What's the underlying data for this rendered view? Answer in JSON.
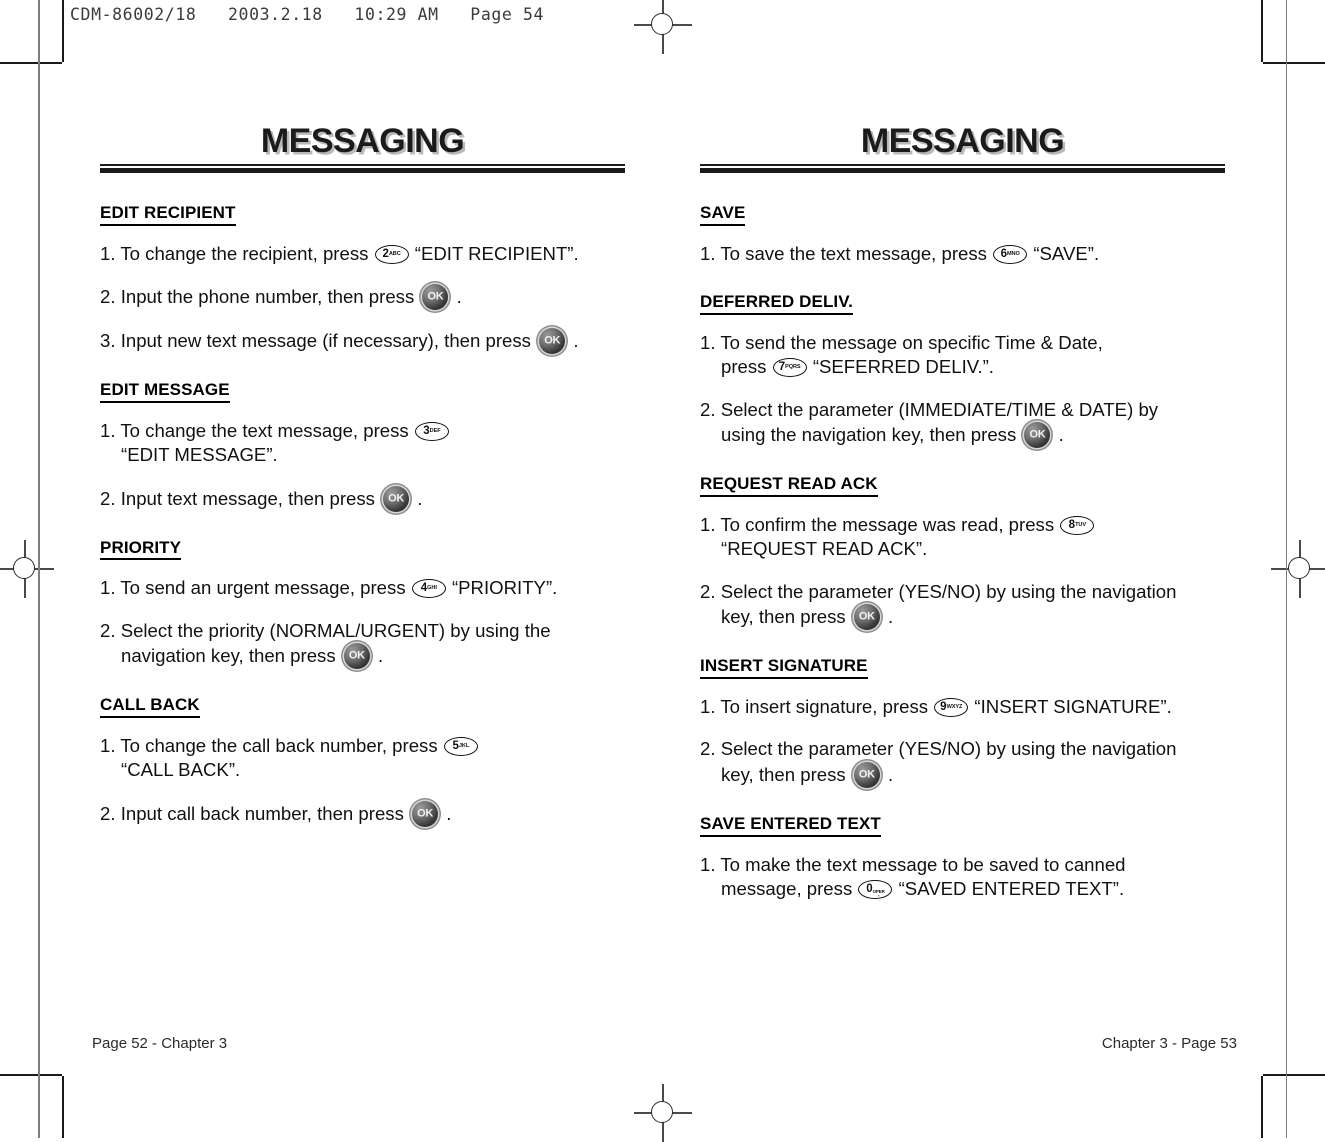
{
  "proof_slug": "CDM-86002/18   2003.2.18   10:29 AM   Page 54",
  "left_page": {
    "title": "MESSAGING",
    "footer": "Page 52 - Chapter 3",
    "sections": [
      {
        "heading": "EDIT RECIPIENT",
        "steps": [
          {
            "number": "1.",
            "parts": [
              {
                "type": "text",
                "value": "To change the recipient, press"
              },
              {
                "type": "key",
                "num": "2",
                "sub": "ABC"
              },
              {
                "type": "text",
                "value": "“EDIT RECIPIENT”."
              }
            ]
          },
          {
            "number": "2.",
            "parts": [
              {
                "type": "text",
                "value": "Input the phone number, then press"
              },
              {
                "type": "okkey",
                "label": "OK"
              },
              {
                "type": "text",
                "value": "."
              }
            ]
          },
          {
            "number": "3.",
            "parts": [
              {
                "type": "text",
                "value": "Input new text message (if necessary), then press"
              },
              {
                "type": "okkey",
                "label": "OK"
              },
              {
                "type": "text",
                "value": "."
              }
            ]
          }
        ]
      },
      {
        "heading": "EDIT MESSAGE",
        "steps": [
          {
            "number": "1.",
            "parts": [
              {
                "type": "text",
                "value": "To change the text message, press"
              },
              {
                "type": "key",
                "num": "3",
                "sub": "DEF"
              },
              {
                "type": "break"
              },
              {
                "type": "text",
                "value": "“EDIT MESSAGE”."
              }
            ]
          },
          {
            "number": "2.",
            "parts": [
              {
                "type": "text",
                "value": " Input text message, then press"
              },
              {
                "type": "okkey",
                "label": "OK"
              },
              {
                "type": "text",
                "value": "."
              }
            ]
          }
        ]
      },
      {
        "heading": "PRIORITY",
        "steps": [
          {
            "number": "1.",
            "parts": [
              {
                "type": "text",
                "value": "To send an urgent message, press"
              },
              {
                "type": "key",
                "num": "4",
                "sub": "GHI"
              },
              {
                "type": "text",
                "value": "“PRIORITY”."
              }
            ]
          },
          {
            "number": "2.",
            "parts": [
              {
                "type": "text",
                "value": "Select the priority (NORMAL/URGENT) by using the"
              },
              {
                "type": "break"
              },
              {
                "type": "text",
                "value": "navigation key, then press"
              },
              {
                "type": "okkey",
                "label": "OK"
              },
              {
                "type": "text",
                "value": "."
              }
            ]
          }
        ]
      },
      {
        "heading": "CALL BACK",
        "steps": [
          {
            "number": "1.",
            "parts": [
              {
                "type": "text",
                "value": "To change the call back number, press"
              },
              {
                "type": "key",
                "num": "5",
                "sub": "JKL"
              },
              {
                "type": "break"
              },
              {
                "type": "text",
                "value": "“CALL BACK”."
              }
            ]
          },
          {
            "number": "2.",
            "parts": [
              {
                "type": "text",
                "value": "Input call back number, then press"
              },
              {
                "type": "okkey",
                "label": "OK"
              },
              {
                "type": "text",
                "value": "."
              }
            ]
          }
        ]
      }
    ]
  },
  "right_page": {
    "title": "MESSAGING",
    "footer": "Chapter 3 - Page 53",
    "sections": [
      {
        "heading": "SAVE",
        "steps": [
          {
            "number": "1.",
            "parts": [
              {
                "type": "text",
                "value": "To save the text message, press"
              },
              {
                "type": "key",
                "num": "6",
                "sub": "MNO"
              },
              {
                "type": "text",
                "value": " “SAVE”."
              }
            ]
          }
        ]
      },
      {
        "heading": "DEFERRED DELIV.",
        "steps": [
          {
            "number": "1.",
            "parts": [
              {
                "type": "text",
                "value": "To send the message on specific Time & Date,"
              },
              {
                "type": "break"
              },
              {
                "type": "text",
                "value": "press"
              },
              {
                "type": "key",
                "num": "7",
                "sub": "PQRS"
              },
              {
                "type": "text",
                "value": "“SEFERRED DELIV.”."
              }
            ]
          },
          {
            "number": "2.",
            "parts": [
              {
                "type": "text",
                "value": "Select the parameter (IMMEDIATE/TIME & DATE) by"
              },
              {
                "type": "break"
              },
              {
                "type": "text",
                "value": "using the navigation key, then press"
              },
              {
                "type": "okkey",
                "label": "OK"
              },
              {
                "type": "text",
                "value": "."
              }
            ]
          }
        ]
      },
      {
        "heading": "REQUEST READ ACK",
        "steps": [
          {
            "number": "1.",
            "parts": [
              {
                "type": "text",
                "value": "To confirm the message was read, press"
              },
              {
                "type": "key",
                "num": "8",
                "sub": "TUV"
              },
              {
                "type": "break"
              },
              {
                "type": "text",
                "value": "“REQUEST READ ACK”."
              }
            ]
          },
          {
            "number": "2.",
            "parts": [
              {
                "type": "text",
                "value": "Select the parameter (YES/NO) by using the navigation"
              },
              {
                "type": "break"
              },
              {
                "type": "text",
                "value": "key, then press"
              },
              {
                "type": "okkey",
                "label": "OK"
              },
              {
                "type": "text",
                "value": "."
              }
            ]
          }
        ]
      },
      {
        "heading": "INSERT SIGNATURE",
        "steps": [
          {
            "number": "1.",
            "parts": [
              {
                "type": "text",
                "value": "To insert signature, press"
              },
              {
                "type": "key",
                "num": "9",
                "sub": "WXYZ"
              },
              {
                "type": "text",
                "value": "“INSERT SIGNATURE”."
              }
            ]
          },
          {
            "number": "2.",
            "parts": [
              {
                "type": "text",
                "value": "Select the parameter (YES/NO) by using the navigation"
              },
              {
                "type": "break"
              },
              {
                "type": "text",
                "value": "key, then press"
              },
              {
                "type": "okkey",
                "label": "OK"
              },
              {
                "type": "text",
                "value": "."
              }
            ]
          }
        ]
      },
      {
        "heading": "SAVE ENTERED TEXT",
        "steps": [
          {
            "number": "1.",
            "parts": [
              {
                "type": "text",
                "value": "To make the text message to be saved to canned"
              },
              {
                "type": "break"
              },
              {
                "type": "text",
                "value": "message, press"
              },
              {
                "type": "key",
                "num": "0",
                "sub": "OPER",
                "zero": true
              },
              {
                "type": "text",
                "value": "“SAVED ENTERED TEXT”."
              }
            ]
          }
        ]
      }
    ]
  }
}
